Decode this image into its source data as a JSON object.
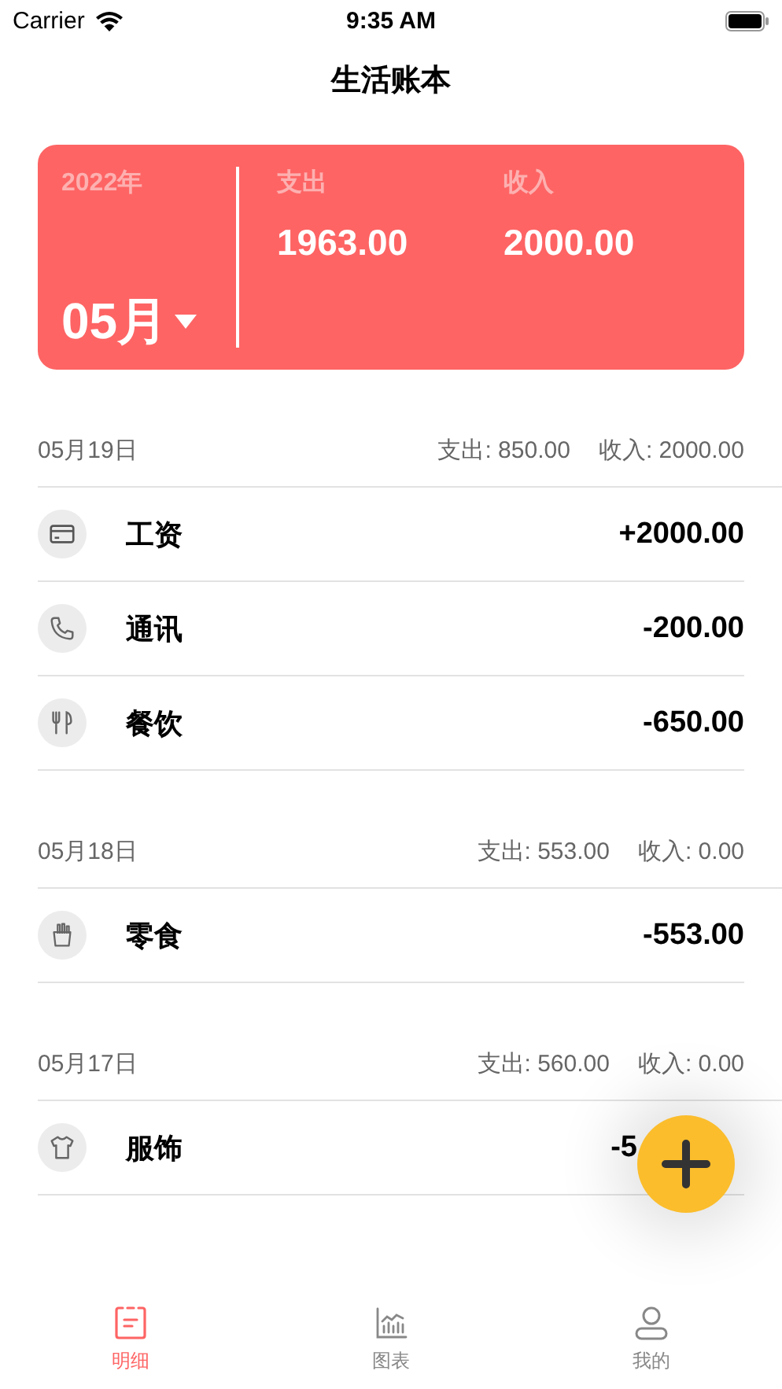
{
  "status_bar": {
    "carrier": "Carrier",
    "time": "9:35 AM"
  },
  "nav": {
    "title": "生活账本"
  },
  "summary": {
    "year": "2022年",
    "month": "05月",
    "expense_label": "支出",
    "expense": "1963.00",
    "income_label": "收入",
    "income": "2000.00"
  },
  "days": [
    {
      "date": "05月19日",
      "expense": "支出: 850.00",
      "income": "收入: 2000.00",
      "entries": [
        {
          "kind": "card",
          "category": "工资",
          "amount": "+2000.00"
        },
        {
          "kind": "phone",
          "category": "通讯",
          "amount": "-200.00"
        },
        {
          "kind": "food",
          "category": "餐饮",
          "amount": "-650.00"
        }
      ]
    },
    {
      "date": "05月18日",
      "expense": "支出: 553.00",
      "income": "收入: 0.00",
      "entries": [
        {
          "kind": "snack",
          "category": "零食",
          "amount": "-553.00"
        }
      ]
    },
    {
      "date": "05月17日",
      "expense": "支出: 560.00",
      "income": "收入: 0.00",
      "entries": [
        {
          "kind": "shirt",
          "category": "服饰",
          "amount": "-5",
          "covered": true
        }
      ]
    }
  ],
  "tabs": [
    {
      "kind": "list",
      "label": "明细",
      "selected": true
    },
    {
      "kind": "chart",
      "label": "图表",
      "selected": false
    },
    {
      "kind": "user",
      "label": "我的",
      "selected": false
    }
  ]
}
